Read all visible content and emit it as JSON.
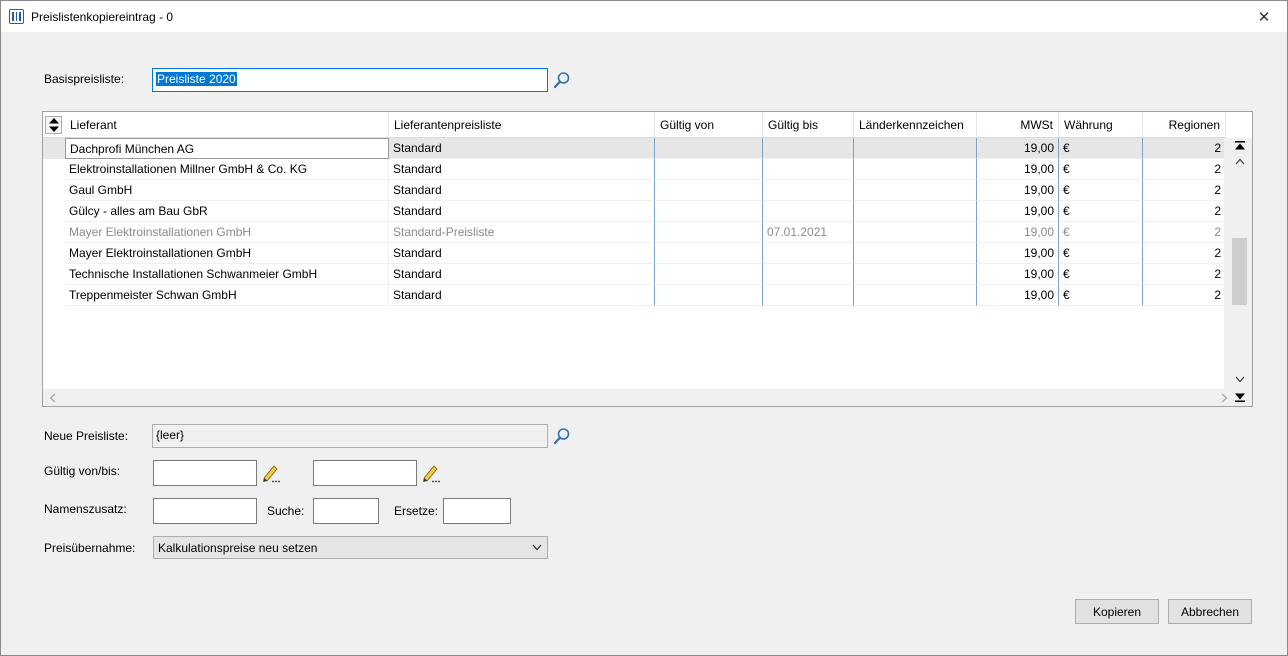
{
  "window": {
    "title": "Preislistenkopiereintrag - 0",
    "close_glyph": "✕"
  },
  "base": {
    "label": "Basispreisliste:",
    "value": "Preisliste 2020"
  },
  "grid": {
    "columns": [
      "Lieferant",
      "Lieferantenpreisliste",
      "Gültig von",
      "Gültig bis",
      "Länderkennzeichen",
      "MWSt",
      "Währung",
      "Regionen"
    ],
    "rows": [
      {
        "supplier": "Dachprofi München AG",
        "pricelist": "Standard",
        "valid_from": "",
        "valid_to": "",
        "country": "",
        "vat": "19,00",
        "currency": "€",
        "regions": "2"
      },
      {
        "supplier": "Elektroinstallationen Millner GmbH & Co. KG",
        "pricelist": "Standard",
        "valid_from": "",
        "valid_to": "",
        "country": "",
        "vat": "19,00",
        "currency": "€",
        "regions": "2"
      },
      {
        "supplier": "Gaul GmbH",
        "pricelist": "Standard",
        "valid_from": "",
        "valid_to": "",
        "country": "",
        "vat": "19,00",
        "currency": "€",
        "regions": "2"
      },
      {
        "supplier": "Gülcy - alles am Bau GbR",
        "pricelist": "Standard",
        "valid_from": "",
        "valid_to": "",
        "country": "",
        "vat": "19,00",
        "currency": "€",
        "regions": "2"
      },
      {
        "supplier": "Mayer Elektroinstallationen GmbH",
        "pricelist": "Standard-Preisliste",
        "valid_from": "",
        "valid_to": "07.01.2021",
        "country": "",
        "vat": "19,00",
        "currency": "€",
        "regions": "2"
      },
      {
        "supplier": "Mayer Elektroinstallationen GmbH",
        "pricelist": "Standard",
        "valid_from": "",
        "valid_to": "",
        "country": "",
        "vat": "19,00",
        "currency": "€",
        "regions": "2"
      },
      {
        "supplier": "Technische Installationen Schwanmeier GmbH",
        "pricelist": "Standard",
        "valid_from": "",
        "valid_to": "",
        "country": "",
        "vat": "19,00",
        "currency": "€",
        "regions": "2"
      },
      {
        "supplier": "Treppenmeister Schwan GmbH",
        "pricelist": "Standard",
        "valid_from": "",
        "valid_to": "",
        "country": "",
        "vat": "19,00",
        "currency": "€",
        "regions": "2"
      }
    ],
    "selected_row": 0,
    "disabled_row": 4
  },
  "form": {
    "new_pricelist_label": "Neue Preisliste:",
    "new_pricelist_value": "{leer}",
    "valid_label": "Gültig von/bis:",
    "valid_from": "",
    "valid_to": "",
    "name_suffix_label": "Namenszusatz:",
    "name_suffix": "",
    "search_label": "Suche:",
    "search_value": "",
    "replace_label": "Ersetze:",
    "replace_value": "",
    "price_transfer_label": "Preisübernahme:",
    "price_transfer_value": "Kalkulationspreise neu setzen"
  },
  "buttons": {
    "copy": "Kopieren",
    "cancel": "Abbrechen"
  },
  "colors": {
    "accent": "#0078d7",
    "grid_separator": "#7ba3c9",
    "selected_row": "#e6e6e6"
  }
}
